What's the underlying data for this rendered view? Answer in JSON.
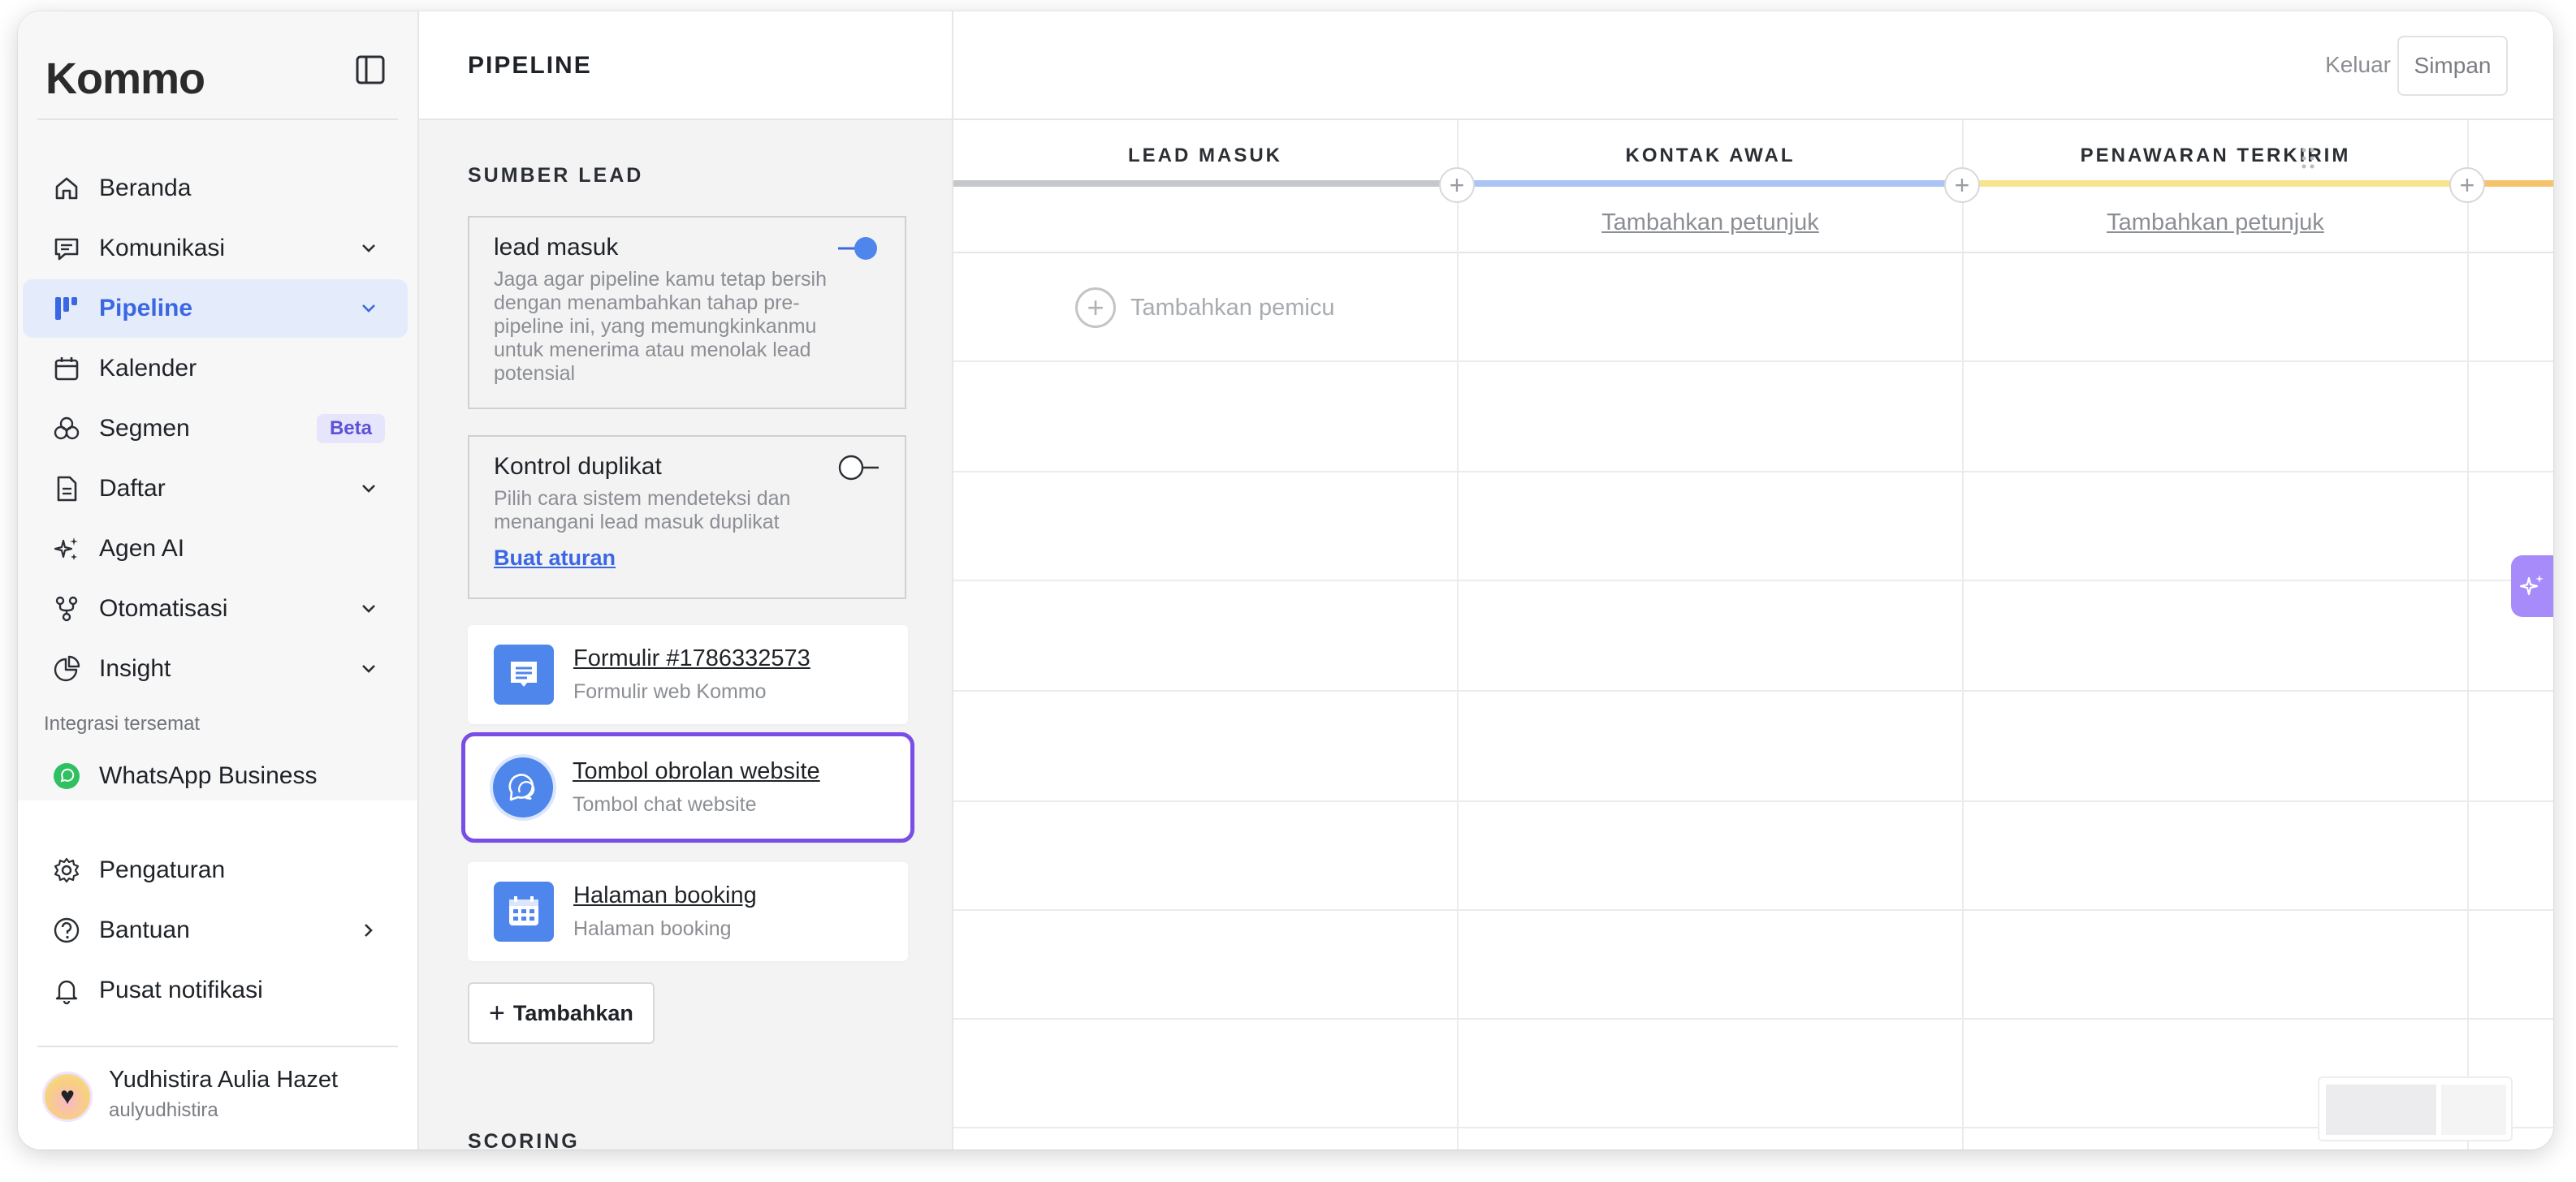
{
  "brand": {
    "logo_text": "Kommo"
  },
  "sidebar": {
    "items": [
      {
        "label": "Beranda"
      },
      {
        "label": "Komunikasi"
      },
      {
        "label": "Pipeline"
      },
      {
        "label": "Kalender"
      },
      {
        "label": "Segmen",
        "badge": "Beta"
      },
      {
        "label": "Daftar"
      },
      {
        "label": "Agen AI"
      },
      {
        "label": "Otomatisasi"
      },
      {
        "label": "Insight"
      }
    ],
    "integrations_label": "Integrasi tersemat",
    "integrations": [
      {
        "label": "WhatsApp Business"
      }
    ],
    "bottom_items": [
      {
        "label": "Pengaturan"
      },
      {
        "label": "Bantuan"
      },
      {
        "label": "Pusat notifikasi"
      }
    ],
    "user": {
      "name": "Yudhistira Aulia Hazet",
      "handle": "aulyudhistira"
    }
  },
  "settings": {
    "title": "PIPELINE",
    "lead_sources_title": "SUMBER LEAD",
    "incoming_lead": {
      "title": "lead masuk",
      "description": "Jaga agar pipeline kamu tetap bersih dengan menambahkan tahap pre-pipeline ini, yang memungkinkanmu untuk menerima atau menolak lead potensial",
      "enabled": true
    },
    "duplicate_control": {
      "title": "Kontrol duplikat",
      "description": "Pilih cara sistem mendeteksi dan menangani lead masuk duplikat",
      "link": "Buat aturan",
      "enabled": false
    },
    "sources": [
      {
        "name": "Formulir #1786332573",
        "sub": "Formulir web Kommo",
        "icon": "form-icon"
      },
      {
        "name": "Tombol obrolan website",
        "sub": "Tombol chat website",
        "icon": "chat-bubble-icon",
        "selected": true
      },
      {
        "name": "Halaman booking",
        "sub": "Halaman booking",
        "icon": "calendar-icon"
      }
    ],
    "add_button": "Tambahkan",
    "scoring_title": "SCORING"
  },
  "board": {
    "cancel": "Keluar",
    "save": "Simpan",
    "columns": [
      {
        "title": "LEAD MASUK",
        "color": "#c6c7ca",
        "hint": ""
      },
      {
        "title": "KONTAK AWAL",
        "color": "#a9c4f5",
        "hint": "Tambahkan petunjuk"
      },
      {
        "title": "PENAWARAN TERKIRIM",
        "color": "#f8e48f",
        "hint": "Tambahkan petunjuk"
      }
    ],
    "add_trigger": "Tambahkan pemicu"
  },
  "colors": {
    "accent": "#3b67e4",
    "selection": "#7a4ee6",
    "ai_button": "#a78bfa"
  }
}
